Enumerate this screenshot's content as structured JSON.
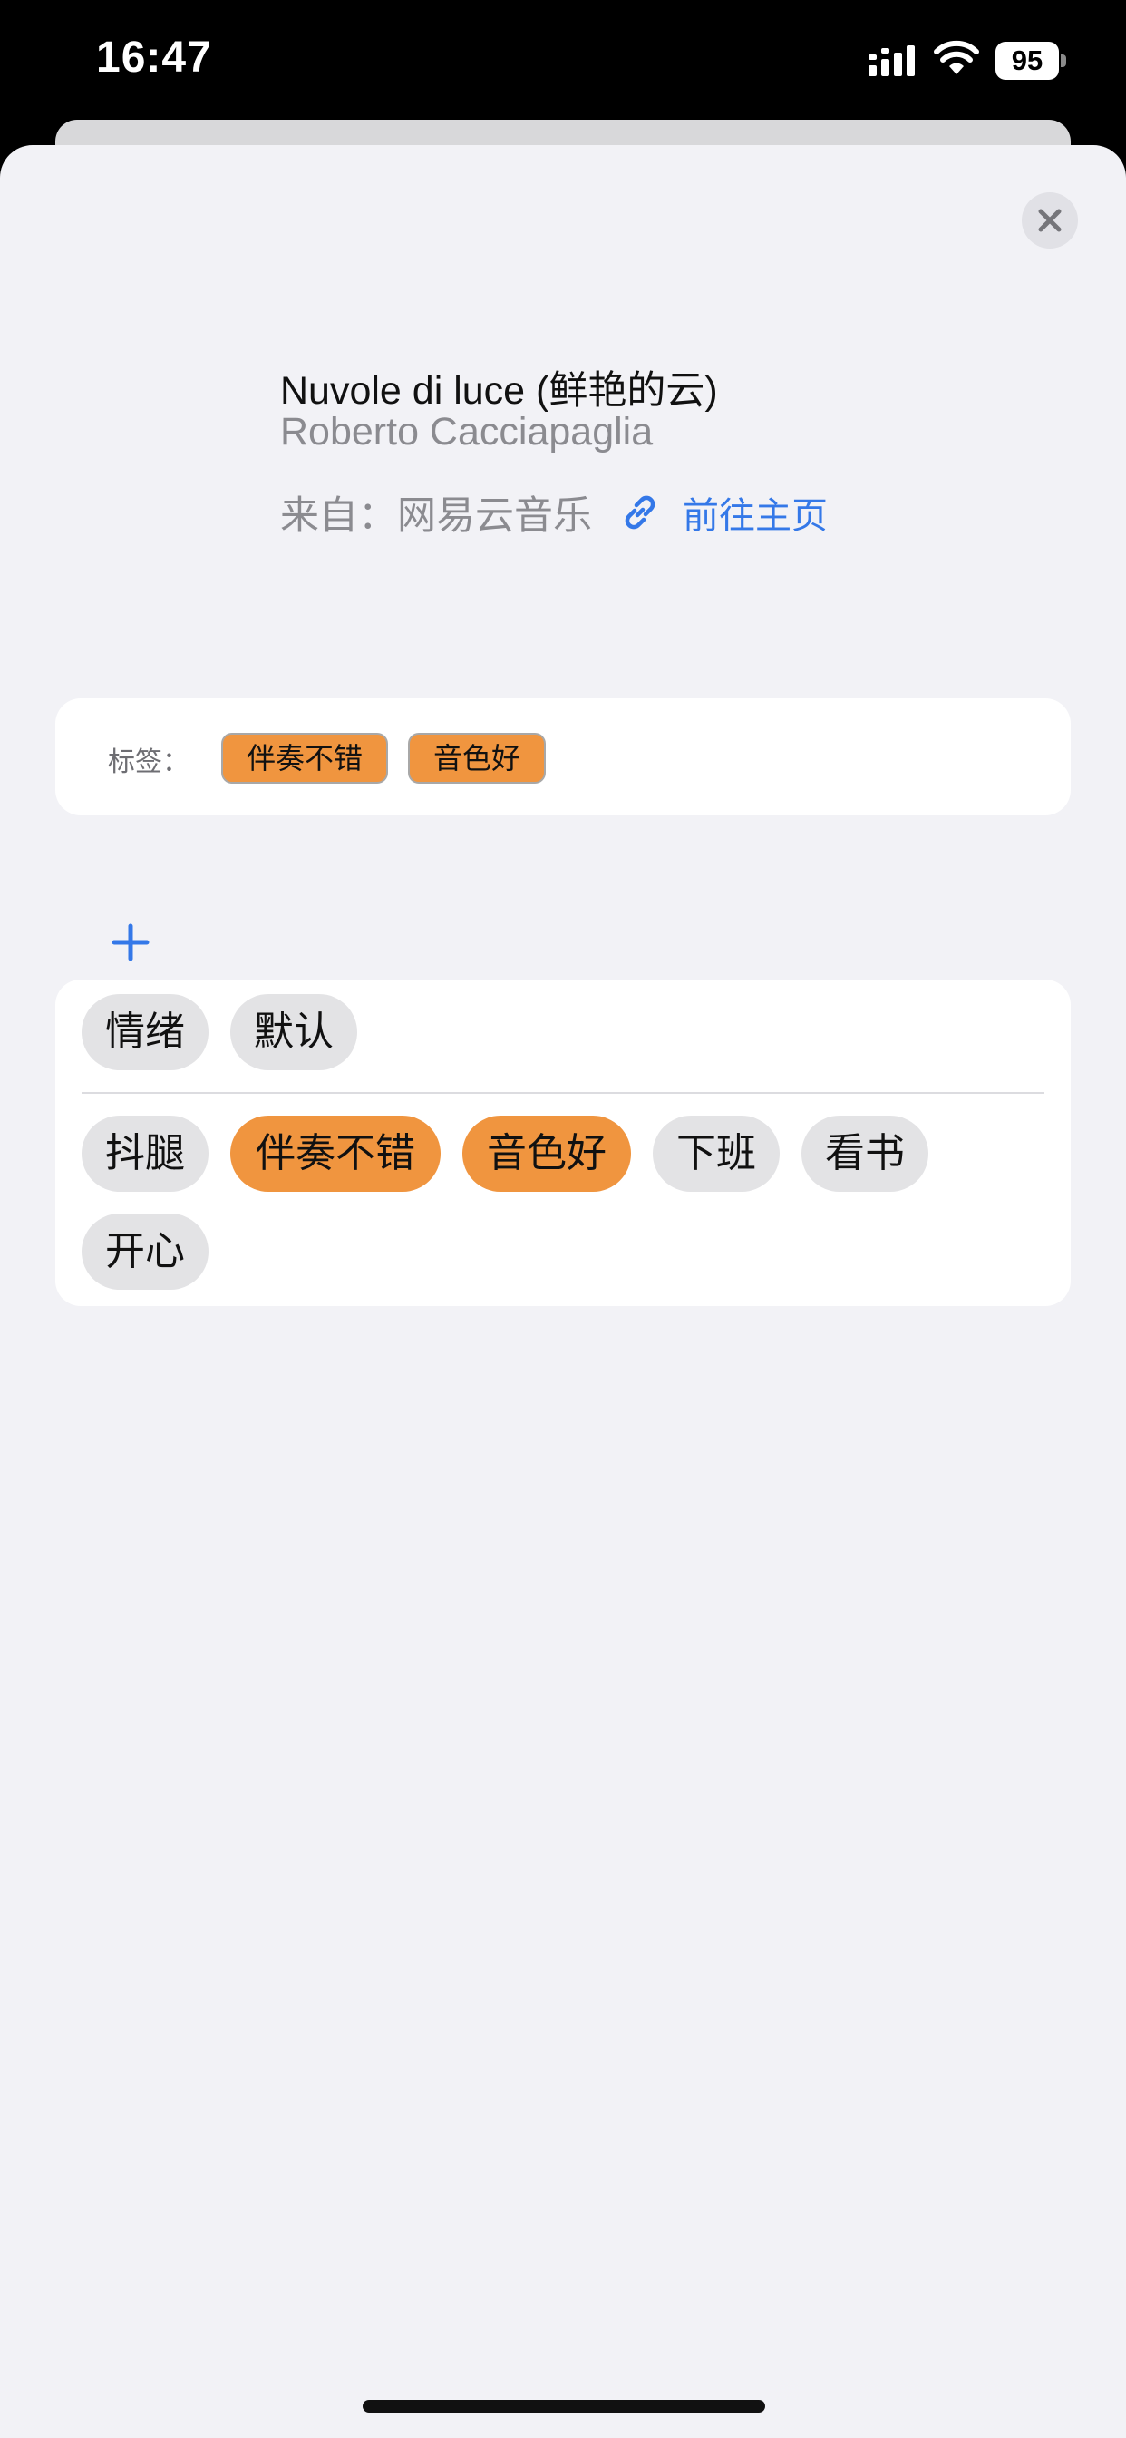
{
  "status_bar": {
    "time": "16:47",
    "battery": "95",
    "icons": [
      "signal-icon",
      "wifi-icon",
      "battery-icon"
    ]
  },
  "song": {
    "title": "Nuvole di luce (鲜艳的云)",
    "artist": "Roberto Cacciapaglia",
    "source": "来自：网易云音乐",
    "homepage_link": "前往主页"
  },
  "tags_card": {
    "label": "标签：",
    "tags": [
      "伴奏不错",
      "音色好"
    ]
  },
  "picker": {
    "categories": [
      "情绪",
      "默认"
    ],
    "options": [
      {
        "label": "抖腿",
        "selected": false
      },
      {
        "label": "伴奏不错",
        "selected": true
      },
      {
        "label": "音色好",
        "selected": true
      },
      {
        "label": "下班",
        "selected": false
      },
      {
        "label": "看书",
        "selected": false
      },
      {
        "label": "开心",
        "selected": false
      }
    ]
  },
  "colors": {
    "accent_orange": "#f0953f",
    "link_blue": "#3478e8",
    "sheet_background": "#f2f2f6"
  }
}
